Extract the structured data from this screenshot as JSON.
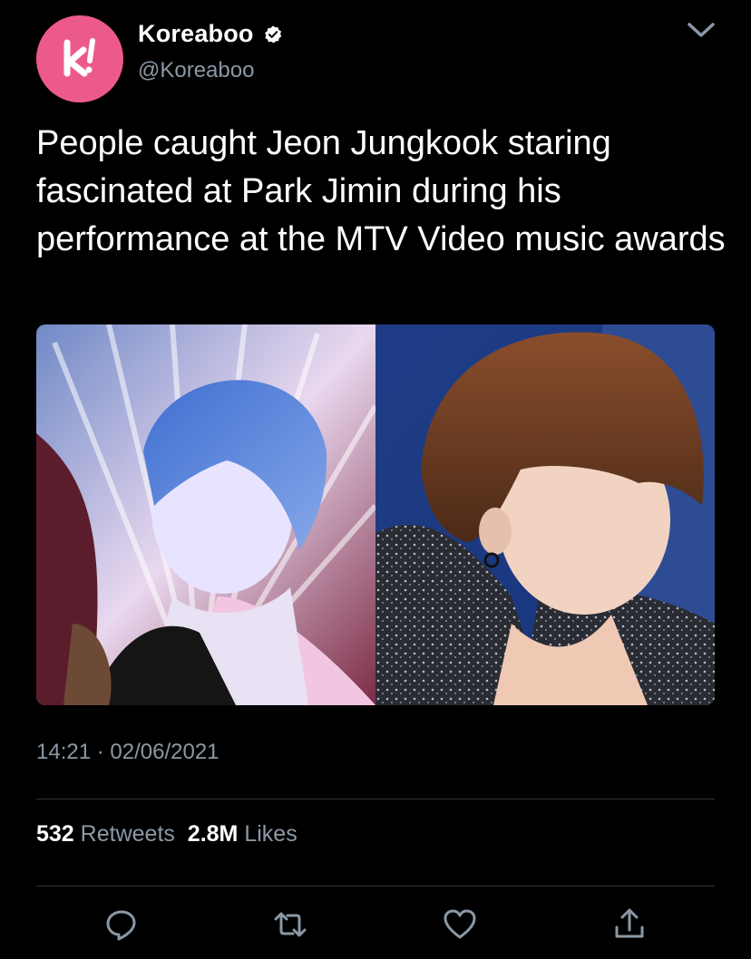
{
  "author": {
    "display_name": "Koreaboo",
    "handle": "@Koreaboo",
    "verified": true,
    "avatar_icon": "koreaboo-k-logo",
    "avatar_color": "#ec5a8c"
  },
  "tweet": {
    "text": "People caught Jeon Jungkook staring fascinated at Park Jimin during his performance at the MTV Video music awards",
    "time": "14:21",
    "separator": "·",
    "date": "02/06/2021"
  },
  "stats": {
    "retweets_count": "532",
    "retweets_label": "Retweets",
    "likes_count": "2.8M",
    "likes_label": "Likes"
  },
  "actions": [
    {
      "name": "reply-icon"
    },
    {
      "name": "retweet-icon"
    },
    {
      "name": "like-icon"
    },
    {
      "name": "share-icon"
    }
  ],
  "colors": {
    "background": "#000000",
    "text": "#ffffff",
    "secondary_text": "#8b98a5",
    "divider": "#2f3336"
  }
}
